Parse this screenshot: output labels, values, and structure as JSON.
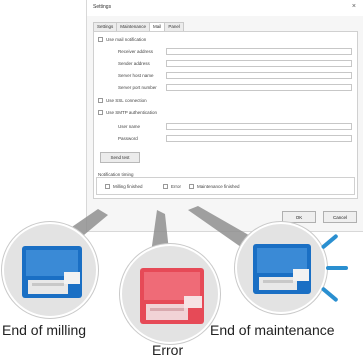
{
  "dialog": {
    "title": "Settings",
    "close_glyph": "×",
    "tabs": [
      "Settings",
      "Maintenance",
      "Mail",
      "Panel"
    ],
    "active_tab": "Mail",
    "use_mail_notification": "Use mail notification",
    "receiver_address": "Receiver address",
    "sender_address": "Sender address",
    "server_host_name": "Server host name",
    "server_port_number": "Server port number",
    "use_ssl": "Use SSL connection",
    "use_smtp_auth": "Use SMTP authentication",
    "user_name": "User name",
    "password": "Password",
    "send_test": "Send test",
    "notification_timing": "Notification timing",
    "timing_end_milling": "Milling finished",
    "timing_error": "Error",
    "timing_end_maintenance": "Maintenance finished",
    "ok": "OK",
    "cancel": "Cancel"
  },
  "captions": {
    "end_of_milling": "End of milling",
    "error": "Error",
    "end_of_maintenance": "End of maintenance"
  },
  "colors": {
    "milling_blue": "#1a6fc4",
    "error_red": "#e64a57",
    "maintenance_blue": "#1a6fc4",
    "ray_blue": "#2a8fd0"
  },
  "icons": {
    "milling": "milling-machine-icon",
    "error": "milling-machine-icon",
    "maintenance": "milling-machine-icon",
    "notification": "notification-rays-icon"
  }
}
